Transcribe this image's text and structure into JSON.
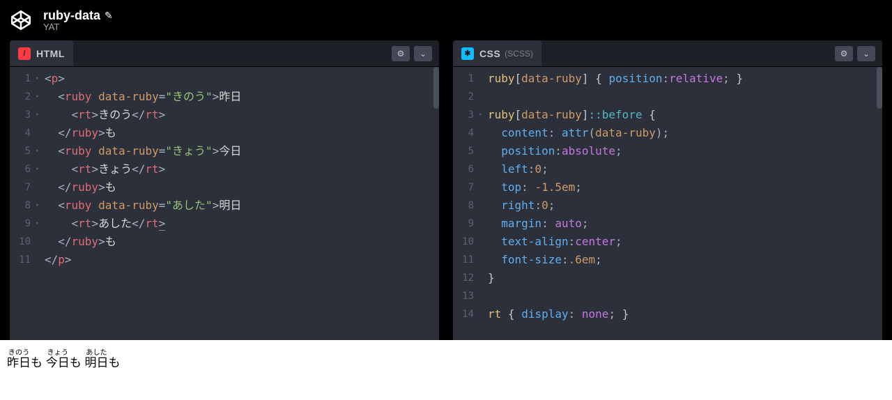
{
  "header": {
    "title": "ruby-data",
    "author": "YAT"
  },
  "panels": {
    "html": {
      "icon_glyph": "/",
      "label": "HTML"
    },
    "css": {
      "icon_glyph": "✱",
      "label": "CSS",
      "sublabel": "(SCSS)"
    }
  },
  "html_code": {
    "l1": {
      "n": "1",
      "i": 0,
      "fold": true,
      "tokens": [
        [
          "punc",
          "<"
        ],
        [
          "tag",
          "p"
        ],
        [
          "punc",
          ">"
        ]
      ]
    },
    "l2": {
      "n": "2",
      "i": 1,
      "fold": true,
      "tokens": [
        [
          "punc",
          "<"
        ],
        [
          "tag",
          "ruby"
        ],
        [
          "txt",
          " "
        ],
        [
          "attr",
          "data-ruby"
        ],
        [
          "punc",
          "="
        ],
        [
          "str",
          "\"きのう\""
        ],
        [
          "punc",
          ">"
        ],
        [
          "txt",
          "昨日"
        ]
      ]
    },
    "l3": {
      "n": "3",
      "i": 2,
      "fold": true,
      "tokens": [
        [
          "punc",
          "<"
        ],
        [
          "tag",
          "rt"
        ],
        [
          "punc",
          ">"
        ],
        [
          "txt",
          "きのう"
        ],
        [
          "punc",
          "</"
        ],
        [
          "tag",
          "rt"
        ],
        [
          "punc",
          ">"
        ]
      ]
    },
    "l4": {
      "n": "4",
      "i": 1,
      "fold": false,
      "tokens": [
        [
          "punc",
          "</"
        ],
        [
          "tag",
          "ruby"
        ],
        [
          "punc",
          ">"
        ],
        [
          "txt",
          "も"
        ]
      ]
    },
    "l5": {
      "n": "5",
      "i": 1,
      "fold": true,
      "tokens": [
        [
          "punc",
          "<"
        ],
        [
          "tag",
          "ruby"
        ],
        [
          "txt",
          " "
        ],
        [
          "attr",
          "data-ruby"
        ],
        [
          "punc",
          "="
        ],
        [
          "str",
          "\"きょう\""
        ],
        [
          "punc",
          ">"
        ],
        [
          "txt",
          "今日"
        ]
      ]
    },
    "l6": {
      "n": "6",
      "i": 2,
      "fold": true,
      "tokens": [
        [
          "punc",
          "<"
        ],
        [
          "tag",
          "rt"
        ],
        [
          "punc",
          ">"
        ],
        [
          "txt",
          "きょう"
        ],
        [
          "punc",
          "</"
        ],
        [
          "tag",
          "rt"
        ],
        [
          "punc",
          ">"
        ]
      ]
    },
    "l7": {
      "n": "7",
      "i": 1,
      "fold": false,
      "tokens": [
        [
          "punc",
          "</"
        ],
        [
          "tag",
          "ruby"
        ],
        [
          "punc",
          ">"
        ],
        [
          "txt",
          "も"
        ]
      ]
    },
    "l8": {
      "n": "8",
      "i": 1,
      "fold": true,
      "tokens": [
        [
          "punc",
          "<"
        ],
        [
          "tag",
          "ruby"
        ],
        [
          "txt",
          " "
        ],
        [
          "attr",
          "data-ruby"
        ],
        [
          "punc",
          "="
        ],
        [
          "str",
          "\"あした\""
        ],
        [
          "punc",
          ">"
        ],
        [
          "txt",
          "明日"
        ]
      ]
    },
    "l9": {
      "n": "9",
      "i": 2,
      "fold": true,
      "tokens": [
        [
          "punc",
          "<"
        ],
        [
          "tag",
          "rt"
        ],
        [
          "punc",
          ">"
        ],
        [
          "txt",
          "あした"
        ],
        [
          "punc",
          "</"
        ],
        [
          "tag",
          "rt"
        ],
        [
          "punc",
          ">"
        ]
      ],
      "cursor": true
    },
    "l10": {
      "n": "10",
      "i": 1,
      "fold": false,
      "tokens": [
        [
          "punc",
          "</"
        ],
        [
          "tag",
          "ruby"
        ],
        [
          "punc",
          ">"
        ],
        [
          "txt",
          "も"
        ]
      ]
    },
    "l11": {
      "n": "11",
      "i": 0,
      "fold": false,
      "tokens": [
        [
          "punc",
          "</"
        ],
        [
          "tag",
          "p"
        ],
        [
          "punc",
          ">"
        ]
      ]
    }
  },
  "css_code": {
    "l1": {
      "n": "1",
      "i": 0,
      "fold": false,
      "tokens": [
        [
          "sel",
          "ruby"
        ],
        [
          "brk",
          "["
        ],
        [
          "attr",
          "data-ruby"
        ],
        [
          "brk",
          "]"
        ],
        [
          "txt",
          " "
        ],
        [
          "brk",
          "{"
        ],
        [
          "txt",
          " "
        ],
        [
          "prop",
          "position"
        ],
        [
          "punc",
          ":"
        ],
        [
          "valkw",
          "relative"
        ],
        [
          "punc",
          ";"
        ],
        [
          "txt",
          " "
        ],
        [
          "brk",
          "}"
        ]
      ]
    },
    "l2": {
      "n": "2",
      "i": 0,
      "fold": false,
      "tokens": []
    },
    "l3": {
      "n": "3",
      "i": 0,
      "fold": true,
      "tokens": [
        [
          "sel",
          "ruby"
        ],
        [
          "brk",
          "["
        ],
        [
          "attr",
          "data-ruby"
        ],
        [
          "brk",
          "]"
        ],
        [
          "pseudo",
          "::before"
        ],
        [
          "txt",
          " "
        ],
        [
          "brk",
          "{"
        ]
      ]
    },
    "l4": {
      "n": "4",
      "i": 1,
      "fold": false,
      "tokens": [
        [
          "prop",
          "content"
        ],
        [
          "punc",
          ":"
        ],
        [
          "txt",
          " "
        ],
        [
          "fn",
          "attr"
        ],
        [
          "punc",
          "("
        ],
        [
          "attr",
          "data-ruby"
        ],
        [
          "punc",
          ")"
        ],
        [
          "punc",
          ";"
        ]
      ]
    },
    "l5": {
      "n": "5",
      "i": 1,
      "fold": false,
      "tokens": [
        [
          "prop",
          "position"
        ],
        [
          "punc",
          ":"
        ],
        [
          "valkw",
          "absolute"
        ],
        [
          "punc",
          ";"
        ]
      ]
    },
    "l6": {
      "n": "6",
      "i": 1,
      "fold": false,
      "tokens": [
        [
          "prop",
          "left"
        ],
        [
          "punc",
          ":"
        ],
        [
          "val",
          "0"
        ],
        [
          "punc",
          ";"
        ]
      ]
    },
    "l7": {
      "n": "7",
      "i": 1,
      "fold": false,
      "tokens": [
        [
          "prop",
          "top"
        ],
        [
          "punc",
          ":"
        ],
        [
          "txt",
          " "
        ],
        [
          "val",
          "-1.5em"
        ],
        [
          "punc",
          ";"
        ]
      ]
    },
    "l8": {
      "n": "8",
      "i": 1,
      "fold": false,
      "tokens": [
        [
          "prop",
          "right"
        ],
        [
          "punc",
          ":"
        ],
        [
          "val",
          "0"
        ],
        [
          "punc",
          ";"
        ]
      ]
    },
    "l9": {
      "n": "9",
      "i": 1,
      "fold": false,
      "tokens": [
        [
          "prop",
          "margin"
        ],
        [
          "punc",
          ":"
        ],
        [
          "txt",
          " "
        ],
        [
          "valkw",
          "auto"
        ],
        [
          "punc",
          ";"
        ]
      ]
    },
    "l10": {
      "n": "10",
      "i": 1,
      "fold": false,
      "tokens": [
        [
          "prop",
          "text-align"
        ],
        [
          "punc",
          ":"
        ],
        [
          "valkw",
          "center"
        ],
        [
          "punc",
          ";"
        ]
      ]
    },
    "l11": {
      "n": "11",
      "i": 1,
      "fold": false,
      "tokens": [
        [
          "prop",
          "font-size"
        ],
        [
          "punc",
          ":"
        ],
        [
          "val",
          ".6em"
        ],
        [
          "punc",
          ";"
        ]
      ]
    },
    "l12": {
      "n": "12",
      "i": 0,
      "fold": false,
      "tokens": [
        [
          "brk",
          "}"
        ]
      ]
    },
    "l13": {
      "n": "13",
      "i": 0,
      "fold": false,
      "tokens": []
    },
    "l14": {
      "n": "14",
      "i": 0,
      "fold": false,
      "tokens": [
        [
          "sel",
          "rt"
        ],
        [
          "txt",
          " "
        ],
        [
          "brk",
          "{"
        ],
        [
          "txt",
          " "
        ],
        [
          "prop",
          "display"
        ],
        [
          "punc",
          ":"
        ],
        [
          "txt",
          " "
        ],
        [
          "valkw",
          "none"
        ],
        [
          "punc",
          ";"
        ],
        [
          "txt",
          " "
        ],
        [
          "brk",
          "}"
        ]
      ]
    }
  },
  "output": {
    "items": [
      {
        "base": "昨日",
        "ruby": "きのう",
        "suffix": "も "
      },
      {
        "base": "今日",
        "ruby": "きょう",
        "suffix": "も "
      },
      {
        "base": "明日",
        "ruby": "あした",
        "suffix": "も"
      }
    ]
  }
}
